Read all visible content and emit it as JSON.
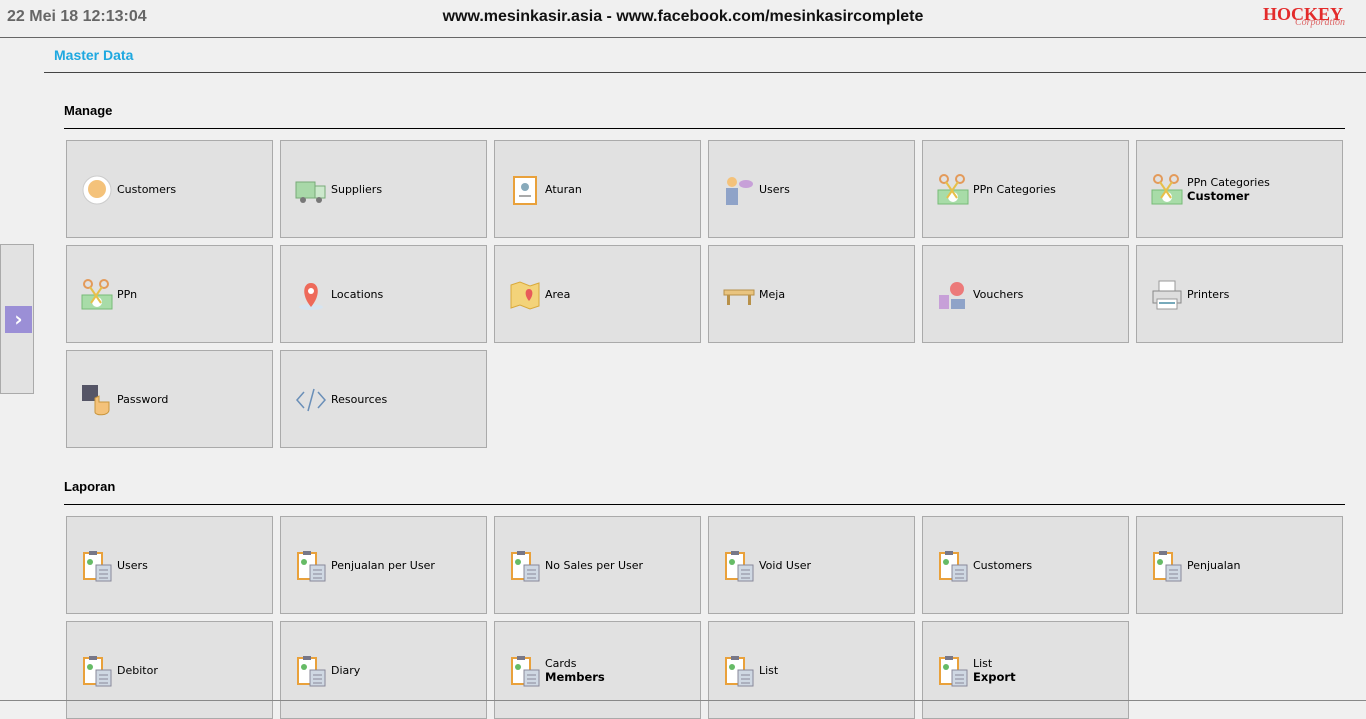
{
  "header": {
    "clock": "22 Mei 18 12:13:04",
    "site": "www.mesinkasir.asia - www.facebook.com/mesinkasircomplete",
    "logo": "HOCKEY",
    "logo_sub": "Corporation"
  },
  "breadcrumb": "Master Data",
  "sidebar": {
    "toggle_icon": "chevron-right-icon",
    "accent": "#9b8fd6"
  },
  "sections": [
    {
      "title": "Manage",
      "tiles": [
        {
          "label": "Customers",
          "icon": "customer-icon"
        },
        {
          "label": "Suppliers",
          "icon": "truck-icon"
        },
        {
          "label": "Aturan",
          "icon": "id-card-icon"
        },
        {
          "label": "Users",
          "icon": "waiter-icon"
        },
        {
          "label": "PPn Categories",
          "icon": "tax-scissors-icon"
        },
        {
          "label": "PPn Categories",
          "sub": "Customer",
          "icon": "tax-scissors-icon"
        },
        {
          "label": "PPn",
          "icon": "tax-scissors-icon"
        },
        {
          "label": "Locations",
          "icon": "map-pin-icon"
        },
        {
          "label": "Area",
          "icon": "map-icon"
        },
        {
          "label": "Meja",
          "icon": "table-icon"
        },
        {
          "label": "Vouchers",
          "icon": "voucher-icon"
        },
        {
          "label": "Printers",
          "icon": "printer-icon"
        },
        {
          "label": "Password",
          "icon": "keypad-icon"
        },
        {
          "label": "Resources",
          "icon": "code-icon"
        }
      ]
    },
    {
      "title": "Laporan",
      "tiles": [
        {
          "label": "Users",
          "icon": "report-icon"
        },
        {
          "label": "Penjualan per User",
          "icon": "report-icon"
        },
        {
          "label": "No Sales per User",
          "icon": "report-icon"
        },
        {
          "label": "Void User",
          "icon": "report-icon"
        },
        {
          "label": "Customers",
          "icon": "report-icon"
        },
        {
          "label": "Penjualan",
          "icon": "report-icon"
        },
        {
          "label": "Debitor",
          "icon": "report-icon"
        },
        {
          "label": "Diary",
          "icon": "report-icon"
        },
        {
          "label": "Cards",
          "sub": "Members",
          "icon": "report-icon"
        },
        {
          "label": "List",
          "icon": "report-icon"
        },
        {
          "label": "List",
          "sub": "Export",
          "icon": "report-icon"
        }
      ]
    }
  ]
}
